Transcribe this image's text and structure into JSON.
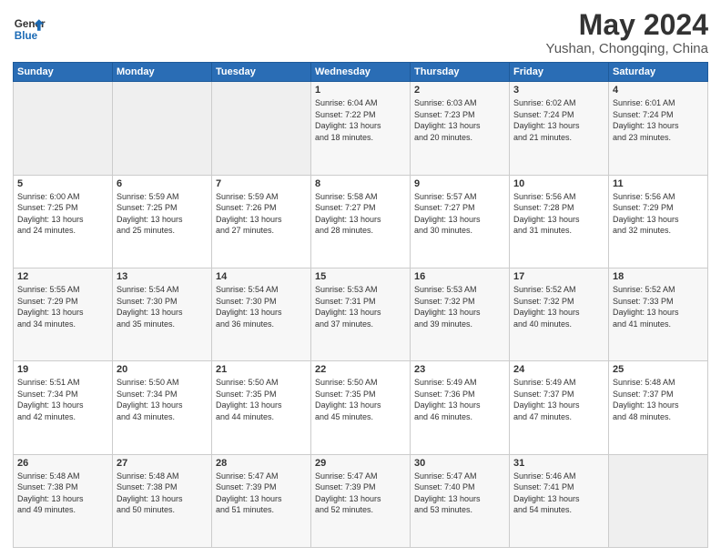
{
  "header": {
    "logo_line1": "General",
    "logo_line2": "Blue",
    "main_title": "May 2024",
    "sub_title": "Yushan, Chongqing, China"
  },
  "days_of_week": [
    "Sunday",
    "Monday",
    "Tuesday",
    "Wednesday",
    "Thursday",
    "Friday",
    "Saturday"
  ],
  "weeks": [
    [
      {
        "day": "",
        "info": ""
      },
      {
        "day": "",
        "info": ""
      },
      {
        "day": "",
        "info": ""
      },
      {
        "day": "1",
        "info": "Sunrise: 6:04 AM\nSunset: 7:22 PM\nDaylight: 13 hours\nand 18 minutes."
      },
      {
        "day": "2",
        "info": "Sunrise: 6:03 AM\nSunset: 7:23 PM\nDaylight: 13 hours\nand 20 minutes."
      },
      {
        "day": "3",
        "info": "Sunrise: 6:02 AM\nSunset: 7:24 PM\nDaylight: 13 hours\nand 21 minutes."
      },
      {
        "day": "4",
        "info": "Sunrise: 6:01 AM\nSunset: 7:24 PM\nDaylight: 13 hours\nand 23 minutes."
      }
    ],
    [
      {
        "day": "5",
        "info": "Sunrise: 6:00 AM\nSunset: 7:25 PM\nDaylight: 13 hours\nand 24 minutes."
      },
      {
        "day": "6",
        "info": "Sunrise: 5:59 AM\nSunset: 7:25 PM\nDaylight: 13 hours\nand 25 minutes."
      },
      {
        "day": "7",
        "info": "Sunrise: 5:59 AM\nSunset: 7:26 PM\nDaylight: 13 hours\nand 27 minutes."
      },
      {
        "day": "8",
        "info": "Sunrise: 5:58 AM\nSunset: 7:27 PM\nDaylight: 13 hours\nand 28 minutes."
      },
      {
        "day": "9",
        "info": "Sunrise: 5:57 AM\nSunset: 7:27 PM\nDaylight: 13 hours\nand 30 minutes."
      },
      {
        "day": "10",
        "info": "Sunrise: 5:56 AM\nSunset: 7:28 PM\nDaylight: 13 hours\nand 31 minutes."
      },
      {
        "day": "11",
        "info": "Sunrise: 5:56 AM\nSunset: 7:29 PM\nDaylight: 13 hours\nand 32 minutes."
      }
    ],
    [
      {
        "day": "12",
        "info": "Sunrise: 5:55 AM\nSunset: 7:29 PM\nDaylight: 13 hours\nand 34 minutes."
      },
      {
        "day": "13",
        "info": "Sunrise: 5:54 AM\nSunset: 7:30 PM\nDaylight: 13 hours\nand 35 minutes."
      },
      {
        "day": "14",
        "info": "Sunrise: 5:54 AM\nSunset: 7:30 PM\nDaylight: 13 hours\nand 36 minutes."
      },
      {
        "day": "15",
        "info": "Sunrise: 5:53 AM\nSunset: 7:31 PM\nDaylight: 13 hours\nand 37 minutes."
      },
      {
        "day": "16",
        "info": "Sunrise: 5:53 AM\nSunset: 7:32 PM\nDaylight: 13 hours\nand 39 minutes."
      },
      {
        "day": "17",
        "info": "Sunrise: 5:52 AM\nSunset: 7:32 PM\nDaylight: 13 hours\nand 40 minutes."
      },
      {
        "day": "18",
        "info": "Sunrise: 5:52 AM\nSunset: 7:33 PM\nDaylight: 13 hours\nand 41 minutes."
      }
    ],
    [
      {
        "day": "19",
        "info": "Sunrise: 5:51 AM\nSunset: 7:34 PM\nDaylight: 13 hours\nand 42 minutes."
      },
      {
        "day": "20",
        "info": "Sunrise: 5:50 AM\nSunset: 7:34 PM\nDaylight: 13 hours\nand 43 minutes."
      },
      {
        "day": "21",
        "info": "Sunrise: 5:50 AM\nSunset: 7:35 PM\nDaylight: 13 hours\nand 44 minutes."
      },
      {
        "day": "22",
        "info": "Sunrise: 5:50 AM\nSunset: 7:35 PM\nDaylight: 13 hours\nand 45 minutes."
      },
      {
        "day": "23",
        "info": "Sunrise: 5:49 AM\nSunset: 7:36 PM\nDaylight: 13 hours\nand 46 minutes."
      },
      {
        "day": "24",
        "info": "Sunrise: 5:49 AM\nSunset: 7:37 PM\nDaylight: 13 hours\nand 47 minutes."
      },
      {
        "day": "25",
        "info": "Sunrise: 5:48 AM\nSunset: 7:37 PM\nDaylight: 13 hours\nand 48 minutes."
      }
    ],
    [
      {
        "day": "26",
        "info": "Sunrise: 5:48 AM\nSunset: 7:38 PM\nDaylight: 13 hours\nand 49 minutes."
      },
      {
        "day": "27",
        "info": "Sunrise: 5:48 AM\nSunset: 7:38 PM\nDaylight: 13 hours\nand 50 minutes."
      },
      {
        "day": "28",
        "info": "Sunrise: 5:47 AM\nSunset: 7:39 PM\nDaylight: 13 hours\nand 51 minutes."
      },
      {
        "day": "29",
        "info": "Sunrise: 5:47 AM\nSunset: 7:39 PM\nDaylight: 13 hours\nand 52 minutes."
      },
      {
        "day": "30",
        "info": "Sunrise: 5:47 AM\nSunset: 7:40 PM\nDaylight: 13 hours\nand 53 minutes."
      },
      {
        "day": "31",
        "info": "Sunrise: 5:46 AM\nSunset: 7:41 PM\nDaylight: 13 hours\nand 54 minutes."
      },
      {
        "day": "",
        "info": ""
      }
    ]
  ]
}
